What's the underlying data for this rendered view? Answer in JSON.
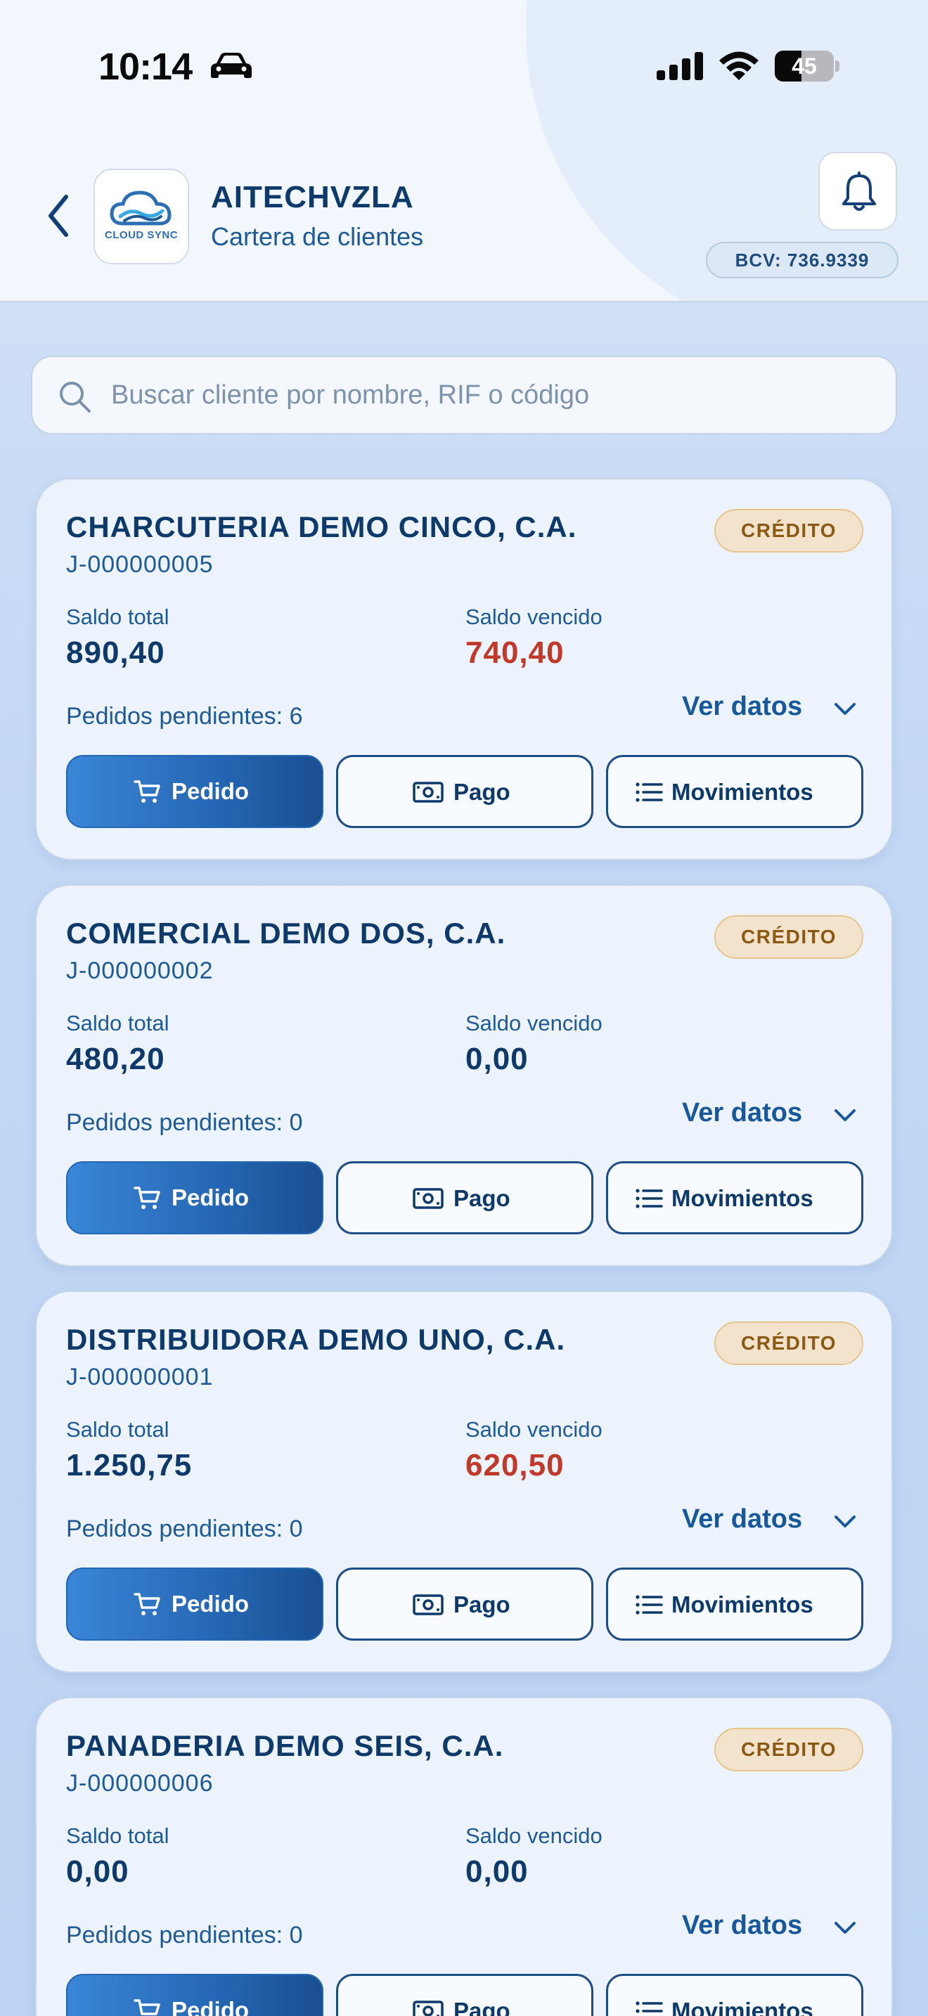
{
  "status_bar": {
    "time": "10:14",
    "battery": "45",
    "battery_level": 0.45
  },
  "header": {
    "company": "AITECHVZLA",
    "subtitle": "Cartera de clientes",
    "logo_text": "CLOUD SYNC",
    "bcv": "BCV: 736.9339"
  },
  "search": {
    "placeholder": "Buscar cliente por nombre, RIF o código",
    "value": ""
  },
  "labels": {
    "badge": "CRÉDITO",
    "saldo_total": "Saldo total",
    "saldo_vencido": "Saldo vencido",
    "ver_datos": "Ver datos",
    "pedido": "Pedido",
    "pago": "Pago",
    "movimientos": "Movimientos"
  },
  "colors": {
    "overdue": "#c0392b",
    "primary": "#2466b3",
    "text": "#0e3a6b",
    "badge_bg": "#f3e3cc"
  },
  "clients": [
    {
      "name": "CHARCUTERIA DEMO CINCO, C.A.",
      "rif": "J-000000005",
      "saldo_total": "890,40",
      "saldo_vencido": "740,40",
      "overdue": true,
      "pendientes": "Pedidos pendientes: 6"
    },
    {
      "name": "COMERCIAL DEMO DOS, C.A.",
      "rif": "J-000000002",
      "saldo_total": "480,20",
      "saldo_vencido": "0,00",
      "overdue": false,
      "pendientes": "Pedidos pendientes: 0"
    },
    {
      "name": "DISTRIBUIDORA DEMO UNO, C.A.",
      "rif": "J-000000001",
      "saldo_total": "1.250,75",
      "saldo_vencido": "620,50",
      "overdue": true,
      "pendientes": "Pedidos pendientes: 0"
    },
    {
      "name": "PANADERIA DEMO SEIS, C.A.",
      "rif": "J-000000006",
      "saldo_total": "0,00",
      "saldo_vencido": "0,00",
      "overdue": false,
      "pendientes": "Pedidos pendientes: 0"
    }
  ]
}
